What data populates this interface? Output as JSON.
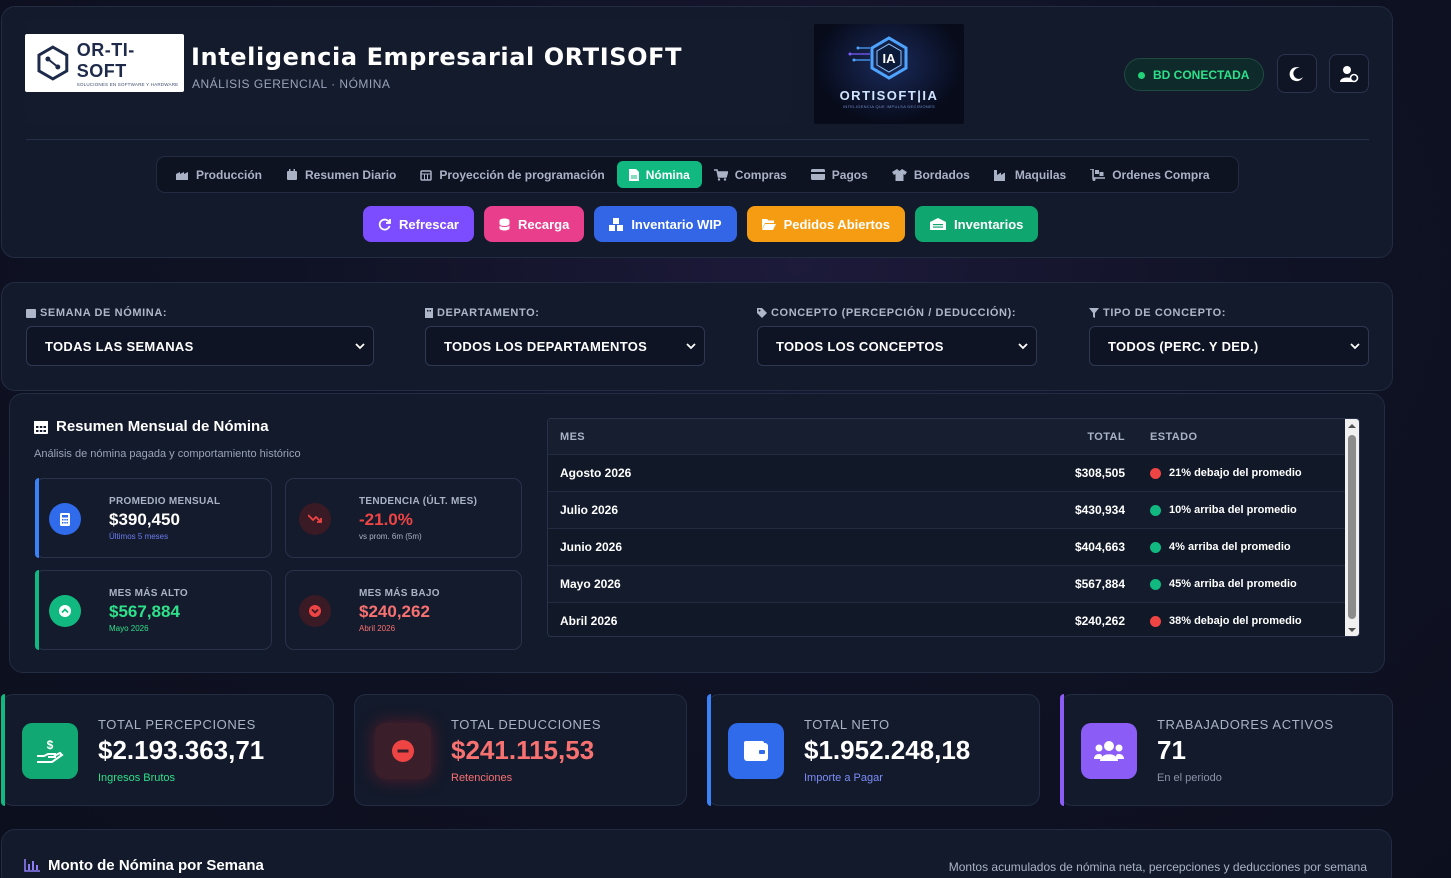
{
  "header": {
    "logo_name": "OR-TI-SOFT",
    "logo_tagline": "SOLUCIONES EN SOFTWARE Y HARDWARE",
    "title": "Inteligencia Empresarial ORTISOFT",
    "subtitle": "ANÁLISIS GERENCIAL · NÓMINA",
    "ia_logo_name": "ORTISOFT|IA",
    "ia_logo_tagline": "INTELIGENCIA QUE IMPULSA DECISIONES",
    "db_status": "BD CONECTADA",
    "theme_icon": "moon-icon",
    "user_icon": "user-settings-icon"
  },
  "nav": [
    {
      "label": "Producción",
      "icon": "factory-icon",
      "active": false
    },
    {
      "label": "Resumen Diario",
      "icon": "calendar-icon",
      "active": false
    },
    {
      "label": "Proyección de programación",
      "icon": "calendar-grid-icon",
      "active": false
    },
    {
      "label": "Nómina",
      "icon": "document-icon",
      "active": true
    },
    {
      "label": "Compras",
      "icon": "cart-icon",
      "active": false
    },
    {
      "label": "Pagos",
      "icon": "card-icon",
      "active": false
    },
    {
      "label": "Bordados",
      "icon": "shirt-icon",
      "active": false
    },
    {
      "label": "Maquilas",
      "icon": "industry-icon",
      "active": false
    },
    {
      "label": "Ordenes Compra",
      "icon": "dolly-icon",
      "active": false
    }
  ],
  "actions": [
    {
      "label": "Refrescar",
      "icon": "refresh-icon",
      "color": "#7c4dff"
    },
    {
      "label": "Recarga",
      "icon": "database-icon",
      "color": "#e83e8c"
    },
    {
      "label": "Inventario WIP",
      "icon": "boxes-icon",
      "color": "#3366e6"
    },
    {
      "label": "Pedidos Abiertos",
      "icon": "folder-open-icon",
      "color": "#f59c12"
    },
    {
      "label": "Inventarios",
      "icon": "warehouse-icon",
      "color": "#10a66f"
    }
  ],
  "filters": [
    {
      "label": "SEMANA DE NÓMINA:",
      "value": "TODAS LAS SEMANAS"
    },
    {
      "label": "DEPARTAMENTO:",
      "value": "TODOS LOS DEPARTAMENTOS"
    },
    {
      "label": "CONCEPTO (PERCEPCIÓN / DEDUCCIÓN):",
      "value": "TODOS LOS CONCEPTOS"
    },
    {
      "label": "TIPO DE CONCEPTO:",
      "value": "TODOS (PERC. Y DED.)"
    }
  ],
  "summary": {
    "title": "Resumen Mensual de Nómina",
    "subtitle": "Análisis de nómina pagada y comportamiento histórico",
    "stats": [
      {
        "label": "PROMEDIO MENSUAL",
        "value": "$390,450",
        "note": "Últimos 5 meses"
      },
      {
        "label": "TENDENCIA (ÚLT. MES)",
        "value": "-21.0%",
        "note": "vs prom. 6m (5m)"
      },
      {
        "label": "MES MÁS ALTO",
        "value": "$567,884",
        "note": "Mayo 2026"
      },
      {
        "label": "MES MÁS BAJO",
        "value": "$240,262",
        "note": "Abril 2026"
      }
    ],
    "table": {
      "headers": [
        "MES",
        "TOTAL",
        "ESTADO"
      ],
      "rows": [
        {
          "mes": "Agosto 2026",
          "total": "$308,505",
          "estado": "21% debajo del promedio",
          "status": "down"
        },
        {
          "mes": "Julio 2026",
          "total": "$430,934",
          "estado": "10% arriba del promedio",
          "status": "up"
        },
        {
          "mes": "Junio 2026",
          "total": "$404,663",
          "estado": "4% arriba del promedio",
          "status": "up"
        },
        {
          "mes": "Mayo 2026",
          "total": "$567,884",
          "estado": "45% arriba del promedio",
          "status": "up"
        },
        {
          "mes": "Abril 2026",
          "total": "$240,262",
          "estado": "38% debajo del promedio",
          "status": "down"
        }
      ]
    }
  },
  "kpis": [
    {
      "label": "TOTAL PERCEPCIONES",
      "value": "$2.193.363,71",
      "note": "Ingresos Brutos",
      "icon": "hand-money-icon"
    },
    {
      "label": "TOTAL DEDUCCIONES",
      "value": "$241.115,53",
      "note": "Retenciones",
      "icon": "minus-circle-icon"
    },
    {
      "label": "TOTAL NETO",
      "value": "$1.952.248,18",
      "note": "Importe a Pagar",
      "icon": "wallet-icon"
    },
    {
      "label": "TRABAJADORES ACTIVOS",
      "value": "71",
      "note": "En el periodo",
      "icon": "users-icon"
    }
  ],
  "weekly": {
    "title": "Monto de Nómina por Semana",
    "subtitle": "Montos acumulados de nómina neta, percepciones y deducciones por semana"
  },
  "colors": {
    "green": "#11b981",
    "red": "#ef4444",
    "blue": "#3b82f6",
    "purple": "#8b5cf6"
  }
}
